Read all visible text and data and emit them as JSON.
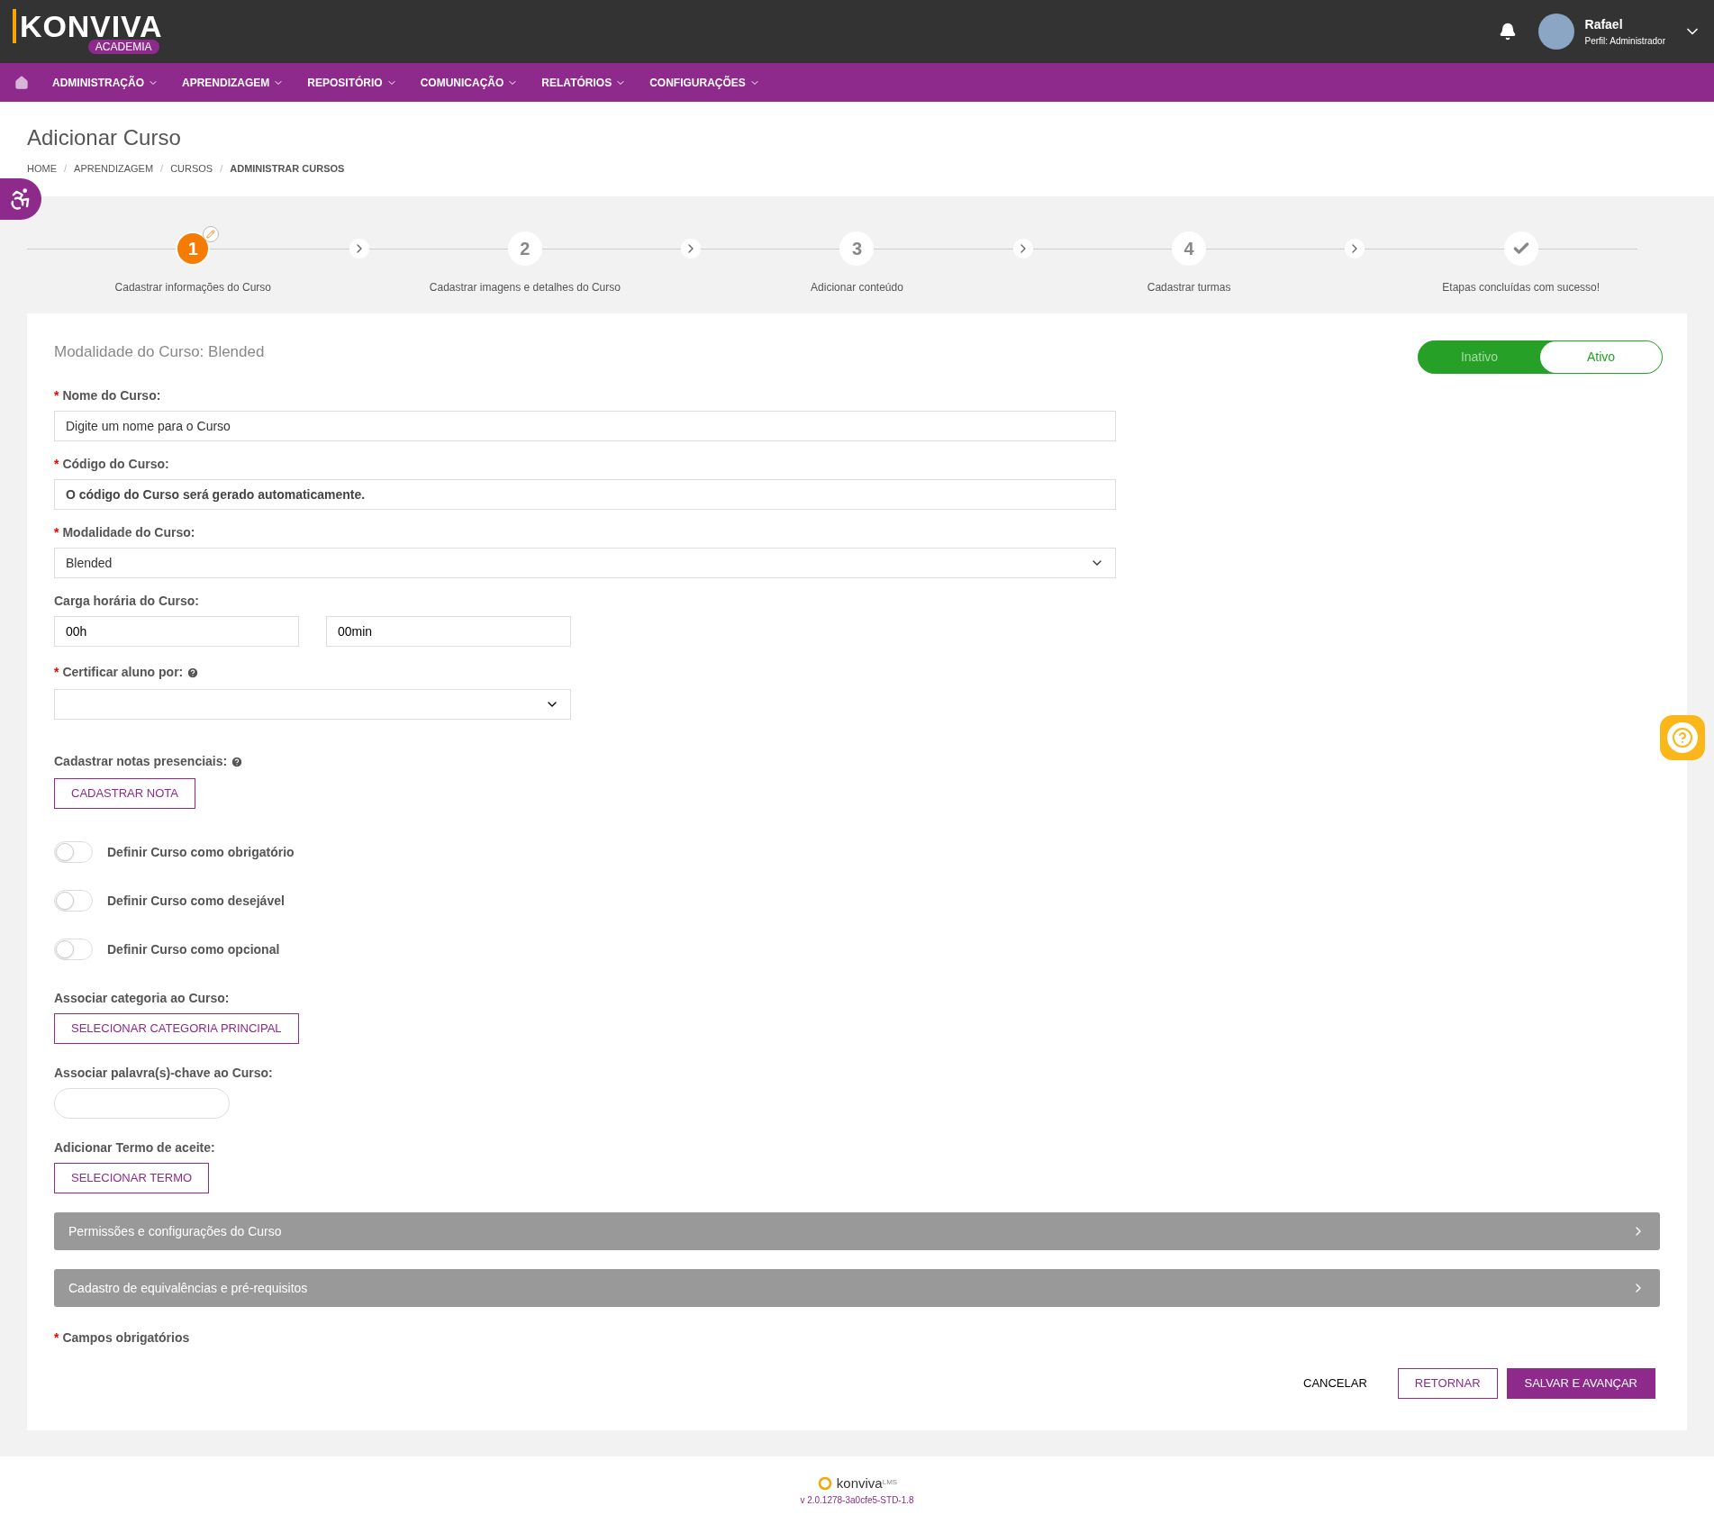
{
  "header": {
    "brand": "KONVIVA",
    "brand_sub": "ACADEMIA",
    "user": {
      "name": "Rafael",
      "role": "Perfil: Administrador"
    }
  },
  "nav": {
    "items": [
      "ADMINISTRAÇÃO",
      "APRENDIZAGEM",
      "REPOSITÓRIO",
      "COMUNICAÇÃO",
      "RELATÓRIOS",
      "CONFIGURAÇÕES"
    ]
  },
  "page": {
    "title": "Adicionar Curso",
    "breadcrumb": [
      "HOME",
      "APRENDIZAGEM",
      "CURSOS",
      "ADMINISTRAR CURSOS"
    ],
    "separator": "/"
  },
  "steps": [
    {
      "kind": "number",
      "number": "1",
      "label": "Cadastrar informações do Curso",
      "selected": true
    },
    {
      "kind": "number",
      "number": "2",
      "label": "Cadastrar imagens e detalhes do Curso",
      "selected": false
    },
    {
      "kind": "number",
      "number": "3",
      "label": "Adicionar conteúdo",
      "selected": false
    },
    {
      "kind": "number",
      "number": "4",
      "label": "Cadastrar turmas",
      "selected": false
    },
    {
      "kind": "check",
      "label": "Etapas concluídas com sucesso!",
      "selected": false
    }
  ],
  "form": {
    "heading": "Modalidade do Curso: Blended",
    "required_mark": "*",
    "status": [
      {
        "label": "Inativo",
        "selected": false
      },
      {
        "label": "Ativo",
        "selected": true
      }
    ],
    "name": {
      "label": "Nome do Curso:",
      "required": true,
      "placeholder": "Digite um nome para o Curso"
    },
    "code": {
      "label": "Código do Curso:",
      "required": true,
      "value": "O código do Curso será gerado automaticamente."
    },
    "modality": {
      "label": "Modalidade do Curso:",
      "required": true,
      "value": "Blended"
    },
    "workload": {
      "label": "Carga horária do Curso:",
      "required": false,
      "hours": "00h",
      "minutes": "00min"
    },
    "certify": {
      "label": "Certificar aluno por:",
      "required": true
    },
    "grades": {
      "label": "Cadastrar notas presenciais:",
      "button": "CADASTRAR NOTA"
    },
    "switches": [
      {
        "label": "Definir Curso como obrigatório",
        "checked": false
      },
      {
        "label": "Definir Curso como desejável",
        "checked": false
      },
      {
        "label": "Definir Curso como opcional",
        "checked": false
      }
    ],
    "category": {
      "label": "Associar categoria ao Curso:",
      "button": "SELECIONAR CATEGORIA PRINCIPAL"
    },
    "keywords": {
      "label": "Associar palavra(s)-chave ao Curso:"
    },
    "terms": {
      "label": "Adicionar Termo de aceite:",
      "button": "SELECIONAR TERMO"
    },
    "sections": [
      "Permissões e configurações do Curso",
      "Cadastro de equivalências e pré-requisitos"
    ],
    "required_note": "Campos obrigatórios",
    "actions": {
      "cancel": "CANCELAR",
      "back": "RETORNAR",
      "save": "SALVAR E AVANÇAR"
    }
  },
  "footer": {
    "brand": "konviva",
    "brand_sup": "LMS",
    "version": "v 2.0.1278-3a0cfe5-STD-1.8"
  }
}
